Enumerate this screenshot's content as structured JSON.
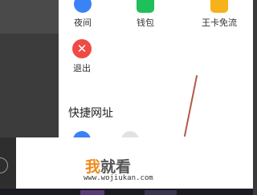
{
  "menu": {
    "row1": [
      {
        "label": "夜间",
        "icon": "night-mode-icon",
        "color": "#3b82f6"
      },
      {
        "label": "钱包",
        "icon": "wallet-icon",
        "color": "#1fbf5a"
      },
      {
        "label": "王卡免流",
        "icon": "king-card-icon",
        "color": "#f5b21b"
      }
    ],
    "exit": {
      "label": "退出",
      "icon": "exit-icon",
      "glyph": "✕",
      "color": "#ef4b44"
    }
  },
  "shortcuts": {
    "title": "快捷网址",
    "items": [
      {
        "icon": "shortcut-site-icon",
        "color": "#3b82f6"
      },
      {
        "icon": "shortcut-site-icon",
        "color": "#e2e2e2"
      }
    ]
  },
  "watermark": {
    "logo_part1": "我",
    "logo_part2": "就看",
    "url": "www.wojiukan.com",
    "colors": {
      "accent": "#f08a1c",
      "text": "#555555"
    }
  }
}
